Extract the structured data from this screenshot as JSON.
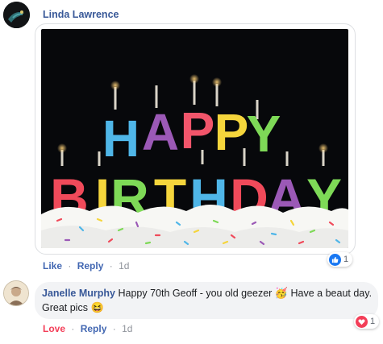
{
  "comment1": {
    "author": "Linda Lawrence",
    "gif_text_line1": "HAPPY",
    "gif_text_line2": "BIRTHDAY",
    "actions": {
      "like": "Like",
      "reply": "Reply",
      "time": "1d",
      "sep": "·"
    },
    "reaction_count": "1",
    "reaction_icon": "like-thumb-icon"
  },
  "comment2": {
    "author": "Janelle Murphy",
    "text_part1": "Happy 70th Geoff - you old geezer",
    "text_part2": "Have a beaut day. Great pics",
    "emoji1": "🥳",
    "emoji2": "😆",
    "actions": {
      "love": "Love",
      "reply": "Reply",
      "time": "1d",
      "sep": "·"
    },
    "reaction_count": "1",
    "reaction_icon": "love-heart-icon"
  },
  "colors": {
    "name": "#385898",
    "link": "#4267b2",
    "love": "#f33e58",
    "meta": "#90949c",
    "bubble": "#f2f3f5"
  }
}
